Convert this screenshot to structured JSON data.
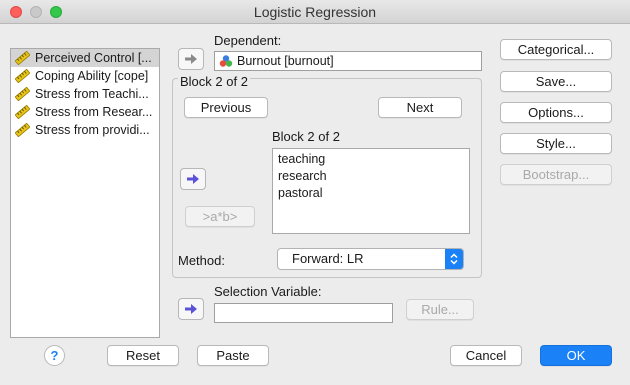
{
  "window": {
    "title": "Logistic Regression"
  },
  "variables": [
    {
      "label": "Perceived Control [..."
    },
    {
      "label": "Coping Ability [cope]"
    },
    {
      "label": "Stress from Teachi..."
    },
    {
      "label": "Stress from Resear..."
    },
    {
      "label": "Stress from providi..."
    }
  ],
  "dependent": {
    "label": "Dependent:",
    "value": "Burnout [burnout]"
  },
  "block": {
    "header": "Block 2 of 2",
    "previous_label": "Previous",
    "next_label": "Next",
    "list_header": "Block 2 of 2",
    "covariates": [
      "teaching",
      "research",
      "pastoral"
    ],
    "interaction_label": ">a*b>"
  },
  "method": {
    "label": "Method:",
    "value": "Forward: LR"
  },
  "selection": {
    "label": "Selection Variable:",
    "value": "",
    "rule_label": "Rule..."
  },
  "side_buttons": {
    "categorical": "Categorical...",
    "save": "Save...",
    "options": "Options...",
    "style": "Style...",
    "bootstrap": "Bootstrap..."
  },
  "footer": {
    "help": "?",
    "reset": "Reset",
    "paste": "Paste",
    "cancel": "Cancel",
    "ok": "OK"
  },
  "colors": {
    "accent": "#1a82f6",
    "arrow": "#5b52d6"
  }
}
